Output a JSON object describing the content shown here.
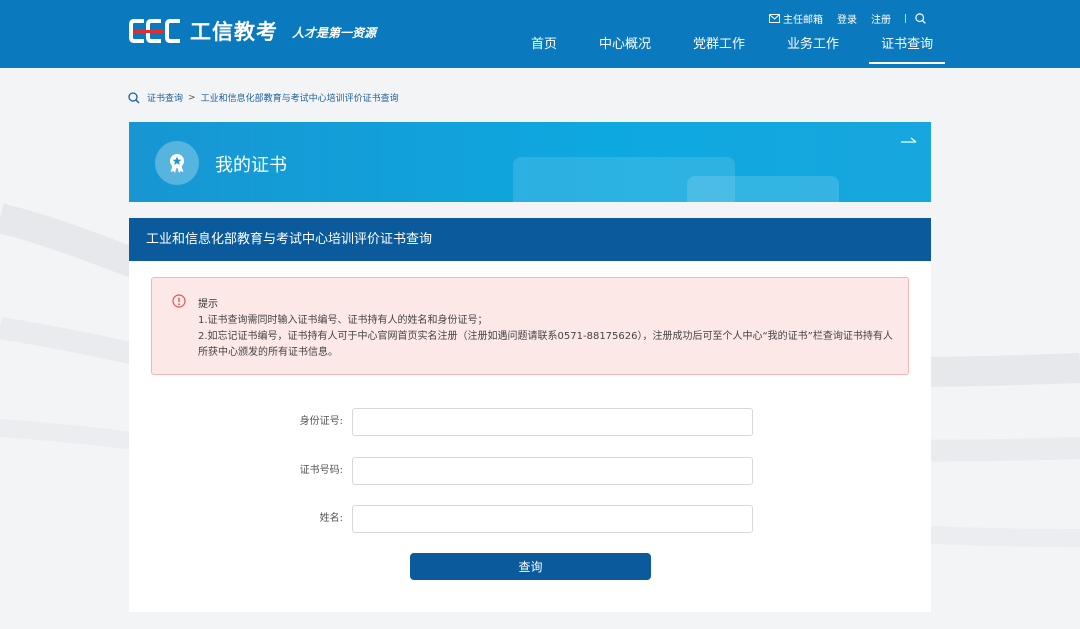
{
  "header": {
    "logo_text": "工信教考",
    "slogan": "人才是第一资源",
    "util": {
      "mail": "主任邮箱",
      "login": "登录",
      "register": "注册"
    },
    "nav": [
      {
        "label": "首页"
      },
      {
        "label": "中心概况"
      },
      {
        "label": "党群工作"
      },
      {
        "label": "业务工作"
      },
      {
        "label": "证书查询",
        "active": true
      }
    ]
  },
  "breadcrumb": {
    "root": "证书查询",
    "current": "工业和信息化部教育与考试中心培训评价证书查询"
  },
  "banner": {
    "title": "我的证书"
  },
  "card": {
    "title": "工业和信息化部教育与考试中心培训评价证书查询",
    "notice": {
      "title": "提示",
      "line1": "1.证书查询需同时输入证书编号、证书持有人的姓名和身份证号；",
      "line2": "2.如忘记证书编号，证书持有人可于中心官网首页实名注册（注册如遇问题请联系0571-88175626），注册成功后可至个人中心“我的证书”栏查询证书持有人所获中心颁发的所有证书信息。"
    },
    "form": {
      "id_label": "身份证号:",
      "id_value": "",
      "cert_label": "证书号码:",
      "cert_value": "",
      "name_label": "姓名:",
      "name_value": "",
      "submit": "查询"
    }
  },
  "colors": {
    "header_bg": "#0a79bd",
    "card_head": "#0a5a9c",
    "notice_bg": "#fde8e8",
    "notice_border": "#f5b5b5",
    "button": "#0a5a9c"
  },
  "icons": [
    "mail-icon",
    "search-icon",
    "certificate-icon",
    "arrow-right-icon",
    "warning-icon"
  ]
}
